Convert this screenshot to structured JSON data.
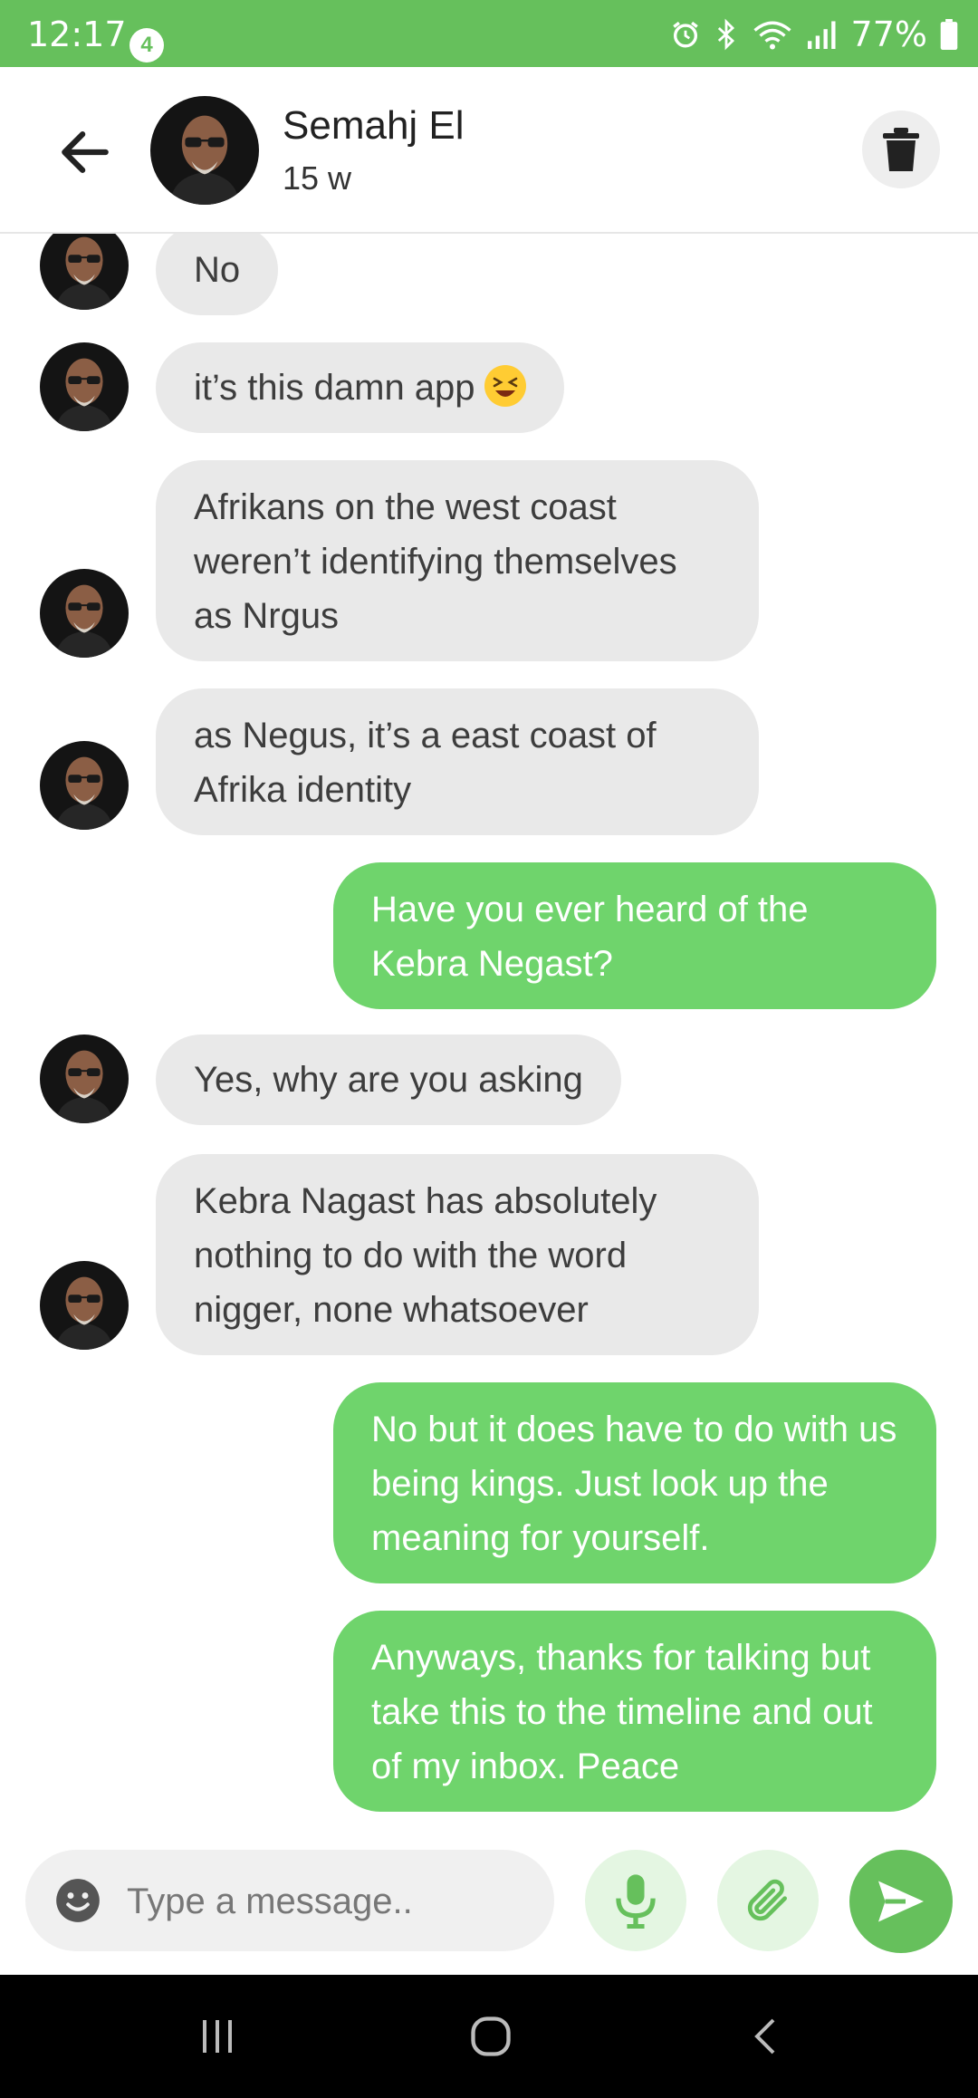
{
  "status_bar": {
    "time": "12:17",
    "notification_count": "4",
    "battery": "77%",
    "icons": [
      "alarm-icon",
      "bluetooth-icon",
      "wifi-icon",
      "signal-icon",
      "battery-icon"
    ]
  },
  "header": {
    "contact_name": "Semahj El",
    "contact_status": "15 w",
    "icons": [
      "back-arrow-icon",
      "trash-icon"
    ]
  },
  "messages": [
    {
      "direction": "in",
      "text": "No"
    },
    {
      "direction": "in",
      "text": "it’s this damn app",
      "emoji": "grinning-squinting-face"
    },
    {
      "direction": "in",
      "text": "Afrikans on the west coast weren’t identifying themselves as Nrgus"
    },
    {
      "direction": "in",
      "text": "as Negus, it’s a east coast of Afrika identity"
    },
    {
      "direction": "out",
      "text": "Have you ever heard of the Kebra Negast?"
    },
    {
      "direction": "in",
      "text": "Yes, why are you asking"
    },
    {
      "direction": "in",
      "text": "Kebra Nagast has absolutely nothing to do with the word nigger, none whatsoever"
    },
    {
      "direction": "out",
      "text": "No but it does have to do with us being kings. Just look up the meaning for yourself."
    },
    {
      "direction": "out",
      "text": "Anyways, thanks for talking but take this to the timeline and out of my inbox. Peace"
    }
  ],
  "composer": {
    "placeholder": "Type a message..",
    "icons": [
      "smiley-icon",
      "microphone-icon",
      "paperclip-icon",
      "send-icon"
    ]
  },
  "colors": {
    "accent": "#66c05c",
    "outgoing_bubble": "#6fd46c",
    "incoming_bubble": "#e9e9e9"
  }
}
